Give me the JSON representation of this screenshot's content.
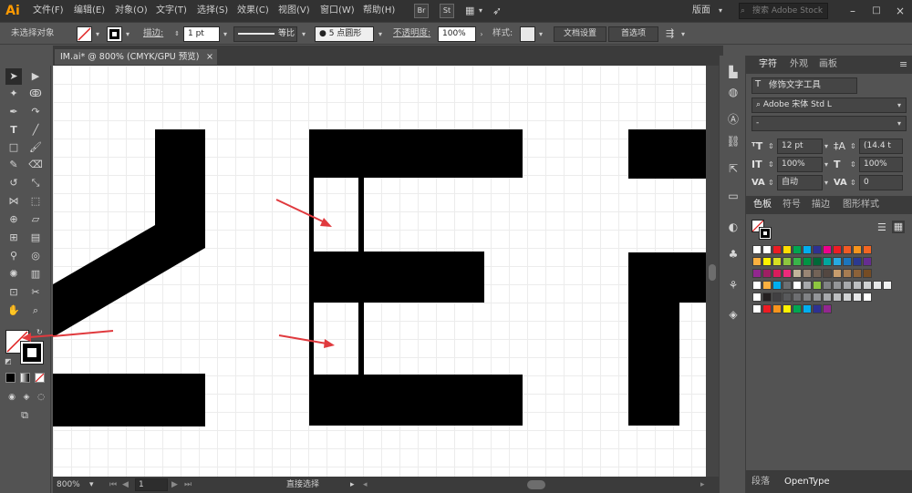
{
  "app": {
    "logo": "Ai"
  },
  "menus": [
    "文件(F)",
    "编辑(E)",
    "对象(O)",
    "文字(T)",
    "选择(S)",
    "效果(C)",
    "视图(V)",
    "窗口(W)",
    "帮助(H)"
  ],
  "bridge_buttons": [
    "Br",
    "St"
  ],
  "workspace_label": "版面",
  "search_placeholder": "搜索 Adobe Stock",
  "control_bar": {
    "selection_status": "未选择对象",
    "stroke_label": "描边:",
    "stroke_value": "1 pt",
    "profile_label": "等比",
    "brush_label": "5 点圆形",
    "opacity_label": "不透明度:",
    "opacity_value": "100%",
    "style_label": "样式:",
    "doc_setup_button": "文档设置",
    "preferences_button": "首选项"
  },
  "document_tab": {
    "title": "IM.ai* @ 800% (CMYK/GPU 预览)",
    "close_glyph": "×"
  },
  "status_bar": {
    "zoom": "800%",
    "page": "1",
    "tool_status": "直接选择"
  },
  "character_panel": {
    "tabs": [
      "字符",
      "外观",
      "画板"
    ],
    "touch_type_button": "修饰文字工具",
    "font_family": "Adobe 宋体 Std L",
    "font_style": "-",
    "font_size": "12 pt",
    "leading": "(14.4 t",
    "vertical_scale": "100%",
    "horizontal_scale": "100%",
    "kerning": "自动",
    "tracking": "0"
  },
  "swatches_panel": {
    "tabs": [
      "色板",
      "符号",
      "描边",
      "图形样式"
    ],
    "colors": {
      "row1": [
        "#ffffff",
        "#ffffff",
        "#ec1c24",
        "#ffdd00",
        "#00a650",
        "#00aeef",
        "#2e3192",
        "#ec008c",
        "#ed1c24",
        "#f15a24",
        "#f7941d",
        "#f26522"
      ],
      "row2": [
        "#fbb040",
        "#fff200",
        "#d7df23",
        "#8dc63f",
        "#39b54a",
        "#009444",
        "#006838",
        "#00a79d",
        "#27aae1",
        "#1c75bc",
        "#2b3990",
        "#662d91"
      ],
      "row3": [
        "#92278f",
        "#9e1f63",
        "#da1c5c",
        "#ee2a7b",
        "#c2b59b",
        "#998675",
        "#736357",
        "#534741",
        "#c69c6d",
        "#a67c52",
        "#8c6239",
        "#754c24"
      ],
      "row4": [
        "#ffffff",
        "#fbb040",
        "#00aeef",
        "#6d6e71",
        "#ffffff",
        "#a7a9ac",
        "#8dc63f",
        "#808285",
        "#939598",
        "#a7a9ac",
        "#bcbec0",
        "#d1d3d4",
        "#e6e7e8",
        "#f1f2f2"
      ],
      "row5": [
        "#ffffff",
        "#231f20",
        "#414042",
        "#58595b",
        "#6d6e71",
        "#808285",
        "#939598",
        "#a7a9ac",
        "#bcbec0",
        "#d1d3d4",
        "#e6e7e8",
        "#ffffff"
      ],
      "row6": [
        "#ffffff",
        "#ed1c24",
        "#f7941d",
        "#fff200",
        "#00a651",
        "#00aeef",
        "#2e3192",
        "#92278f"
      ]
    }
  },
  "bottom_panel_tabs": [
    "段落",
    "OpenType"
  ],
  "colors": {
    "arrow_red": "#e03a3e",
    "canvas_bg": "#ffffff",
    "shape_fill": "#000000"
  }
}
